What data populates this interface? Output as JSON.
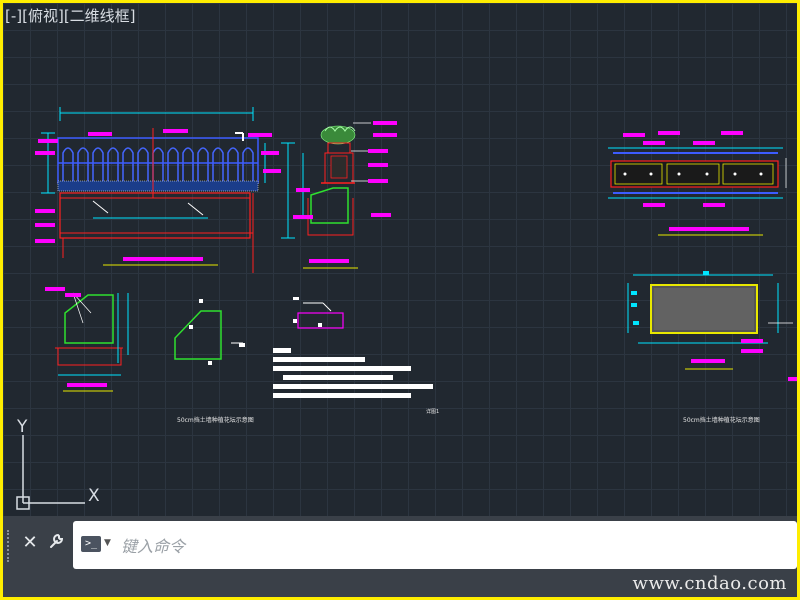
{
  "viewport": {
    "label": "[-][俯视][二维线框]"
  },
  "drawing": {
    "captions": {
      "left_title": "50cm挡土墙种植花坛示意图",
      "center_mark": "详图1",
      "right_title": "50cm挡土墙种植花坛示意图"
    }
  },
  "ucs": {
    "y_label": "Y",
    "x_label": "X"
  },
  "command_line": {
    "close_icon": "close-icon",
    "customize_icon": "wrench-icon",
    "prompt_icon": ">_",
    "placeholder": "键入命令",
    "value": ""
  },
  "watermark": "www.cndao.com",
  "colors": {
    "background": "#212830",
    "frame": "#ffee00",
    "cyan": "#00e5ff",
    "magenta": "#ff00ff",
    "red": "#ff2020",
    "green": "#2fe02f",
    "blue": "#3c5cff",
    "white": "#ffffff",
    "yellow": "#e8e800"
  }
}
